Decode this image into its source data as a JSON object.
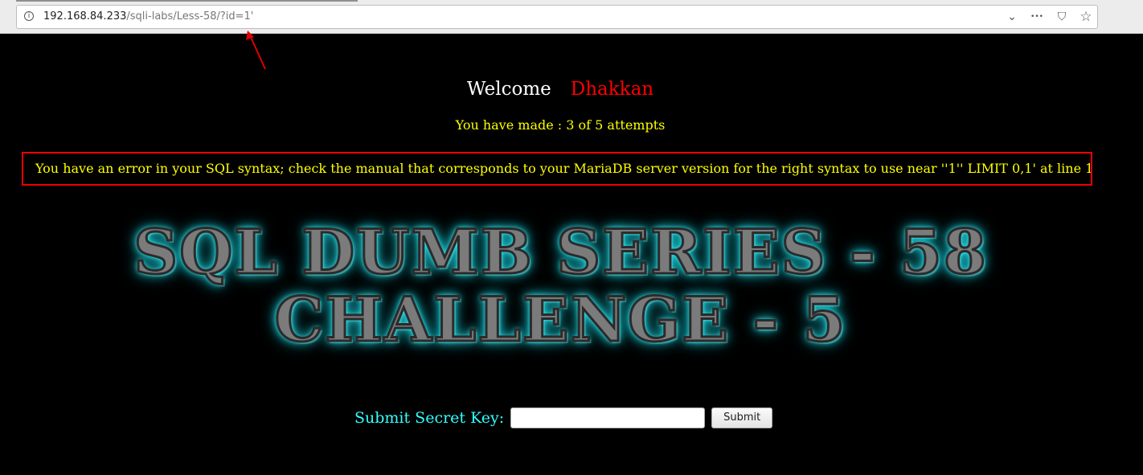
{
  "browser": {
    "url_host": "192.168.84.233",
    "url_path": "/sqli-labs/Less-58/?id=1'",
    "actions": {
      "dropdown_glyph": "⌄",
      "more_glyph": "•••",
      "pocket_glyph": "⛉",
      "bookmark_glyph": "☆"
    }
  },
  "page": {
    "welcome_label": "Welcome",
    "welcome_name": "Dhakkan",
    "attempts_text": "You have made : 3 of 5 attempts",
    "error_text": "You have an error in your SQL syntax; check the manual that corresponds to your MariaDB server version for the right syntax to use near ''1'' LIMIT 0,1' at line 1",
    "banner_line1": "SQL DUMB SERIES - 58",
    "banner_line2": "CHALLENGE - 5",
    "form": {
      "label": "Submit Secret Key:",
      "input_value": "",
      "submit_label": "Submit"
    }
  },
  "colors": {
    "background": "#000000",
    "welcome": "#ffffff",
    "name": "#ff0000",
    "attempts": "#ffff00",
    "error_border": "#e00000",
    "form_label": "#33ffff",
    "annotation_arrow": "#e00000"
  }
}
